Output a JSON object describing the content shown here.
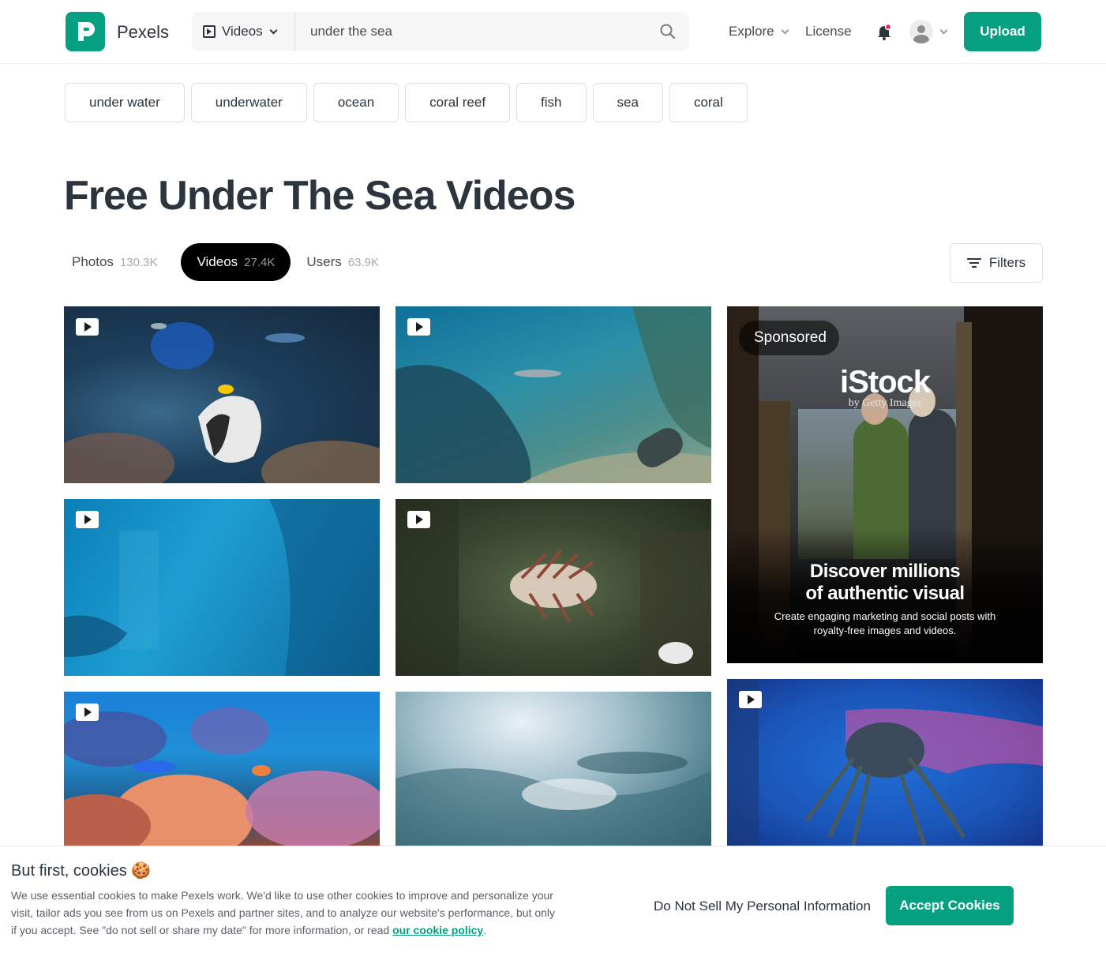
{
  "header": {
    "brand": "Pexels",
    "media_type": "Videos",
    "search_value": "under the sea",
    "nav_explore": "Explore",
    "nav_license": "License",
    "upload_label": "Upload",
    "accent_color": "#05a081"
  },
  "related_searches": [
    "under water",
    "underwater",
    "ocean",
    "coral reef",
    "fish",
    "sea",
    "coral"
  ],
  "page_title": "Free Under The Sea Videos",
  "tabs": [
    {
      "label": "Photos",
      "count": "130.3K"
    },
    {
      "label": "Videos",
      "count": "27.4K"
    },
    {
      "label": "Users",
      "count": "63.9K"
    }
  ],
  "active_tab": "Videos",
  "filters_label": "Filters",
  "sponsored": {
    "tag": "Sponsored",
    "brand": "iStock",
    "brand_sub": "by Getty Images",
    "headline_line1": "Discover millions",
    "headline_line2": "of authentic visual",
    "subtext": "Create engaging marketing and social posts with royalty-free images and videos."
  },
  "cookie_banner": {
    "title": "But first, cookies 🍪",
    "text": "We use essential cookies to make Pexels work. We'd like to use other cookies to improve and personalize your visit, tailor ads you see from us on Pexels and partner sites, and to analyze our website's performance, but only if you accept. See \"do not sell or share my date\" for more information, or read",
    "policy_link": "our cookie policy",
    "do_not_sell": "Do Not Sell My Personal Information",
    "accept_label": "Accept Cookies"
  },
  "icons": {
    "logo": "pexels-logo-icon",
    "search": "search-icon",
    "bell": "bell-icon",
    "avatar": "user-avatar-icon",
    "filters": "filter-lines-icon",
    "play": "play-icon"
  }
}
